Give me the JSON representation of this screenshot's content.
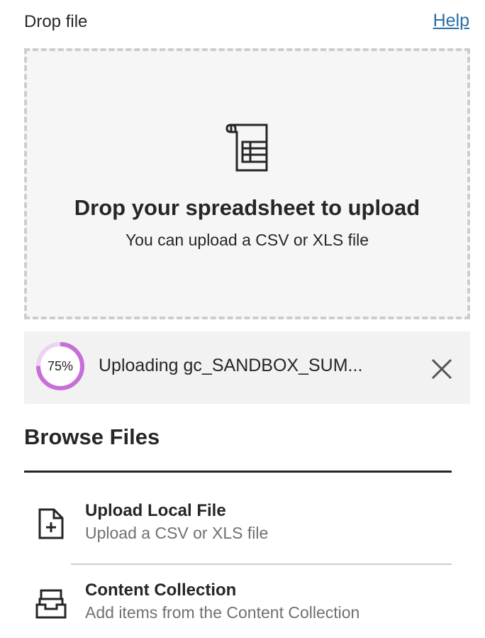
{
  "header": {
    "label": "Drop file",
    "help_link": "Help"
  },
  "dropzone": {
    "icon": "spreadsheet-icon",
    "title": "Drop your spreadsheet to upload",
    "subtitle": "You can upload a CSV or XLS file"
  },
  "upload": {
    "progress_percent": 75,
    "progress_label": "75%",
    "filename_text": "Uploading gc_SANDBOX_SUM...",
    "cancel_icon": "close-icon",
    "progress_color": "#c66fd6",
    "progress_track_color": "#ecd3f2"
  },
  "browse": {
    "title": "Browse Files",
    "options": [
      {
        "icon": "file-plus-icon",
        "title": "Upload Local File",
        "description": "Upload a CSV or XLS file"
      },
      {
        "icon": "inbox-tray-icon",
        "title": "Content Collection",
        "description": "Add items from the Content Collection"
      }
    ]
  },
  "colors": {
    "link": "#2a6fa5",
    "text": "#262626",
    "muted": "#707070",
    "dropzone_bg": "#f6f6f6",
    "dropzone_border": "#cdcdcd"
  }
}
